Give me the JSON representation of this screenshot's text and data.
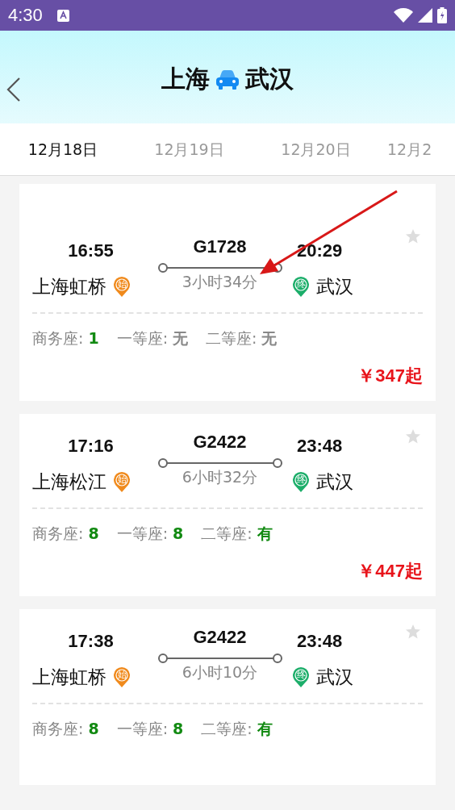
{
  "status_bar": {
    "time": "4:30"
  },
  "header": {
    "origin": "上海",
    "destination": "武汉"
  },
  "date_tabs": [
    {
      "label": "12月18日",
      "selected": true
    },
    {
      "label": "12月19日",
      "selected": false
    },
    {
      "label": "12月20日",
      "selected": false
    },
    {
      "label": "12月2",
      "selected": false
    }
  ],
  "trains": [
    {
      "depart_time": "16:55",
      "train_no": "G1728",
      "arrive_time": "20:29",
      "from_station": "上海虹桥",
      "from_pin": "始",
      "duration": "3小时34分",
      "to_pin": "终",
      "to_station": "武汉",
      "seats": [
        {
          "label": "商务座:",
          "value": "1",
          "available": true
        },
        {
          "label": "一等座:",
          "value": "无",
          "available": false
        },
        {
          "label": "二等座:",
          "value": "无",
          "available": false
        }
      ],
      "price": "￥347起"
    },
    {
      "depart_time": "17:16",
      "train_no": "G2422",
      "arrive_time": "23:48",
      "from_station": "上海松江",
      "from_pin": "始",
      "duration": "6小时32分",
      "to_pin": "终",
      "to_station": "武汉",
      "seats": [
        {
          "label": "商务座:",
          "value": "8",
          "available": true
        },
        {
          "label": "一等座:",
          "value": "8",
          "available": true
        },
        {
          "label": "二等座:",
          "value": "有",
          "available": true
        }
      ],
      "price": "￥447起"
    },
    {
      "depart_time": "17:38",
      "train_no": "G2422",
      "arrive_time": "23:48",
      "from_station": "上海虹桥",
      "from_pin": "始",
      "duration": "6小时10分",
      "to_pin": "终",
      "to_station": "武汉",
      "seats": [
        {
          "label": "商务座:",
          "value": "8",
          "available": true
        },
        {
          "label": "一等座:",
          "value": "8",
          "available": true
        },
        {
          "label": "二等座:",
          "value": "有",
          "available": true
        }
      ]
    }
  ]
}
